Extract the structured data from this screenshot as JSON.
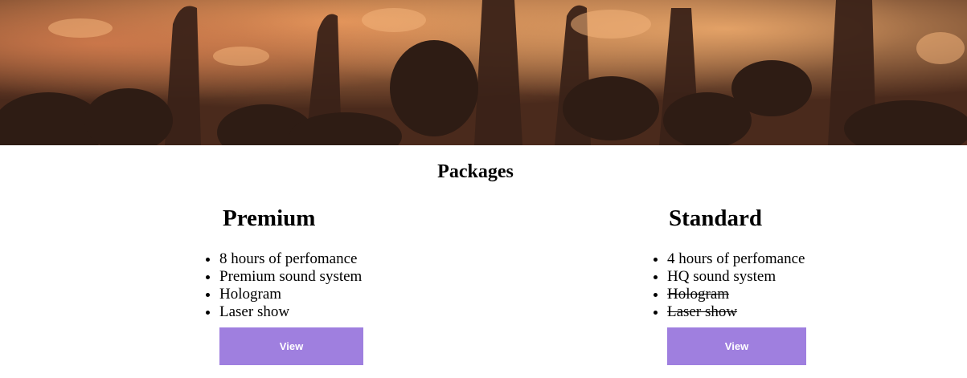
{
  "hero": {
    "image": "concert-crowd-photo"
  },
  "packages_title": "Packages",
  "packages": [
    {
      "name": "Premium",
      "features": [
        {
          "text": "8 hours of perfomance",
          "included": true
        },
        {
          "text": "Premium sound system",
          "included": true
        },
        {
          "text": "Hologram",
          "included": true
        },
        {
          "text": "Laser show",
          "included": true
        }
      ],
      "button_label": "View"
    },
    {
      "name": "Standard",
      "features": [
        {
          "text": "4 hours of perfomance",
          "included": true
        },
        {
          "text": "HQ sound system",
          "included": true
        },
        {
          "text": "Hologram",
          "included": false
        },
        {
          "text": "Laser show",
          "included": false
        }
      ],
      "button_label": "View"
    }
  ],
  "colors": {
    "button_bg": "#9f7fdf",
    "button_text": "#ffffff"
  }
}
